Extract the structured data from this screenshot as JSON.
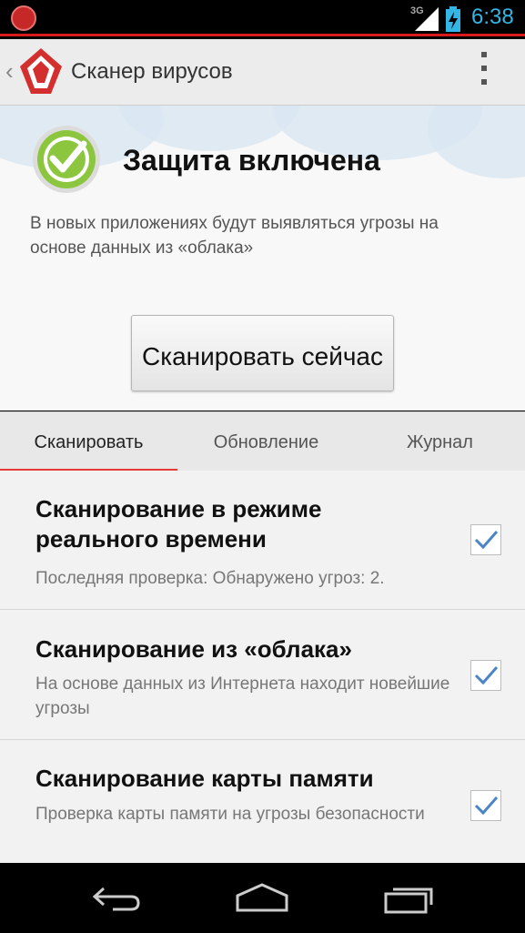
{
  "status_bar": {
    "network": "3G",
    "time": "6:38"
  },
  "action_bar": {
    "title": "Сканер вирусов"
  },
  "protection": {
    "title": "Защита включена",
    "description": "В новых приложениях будут выявляться угрозы на основе данных из «облака»",
    "scan_button": "Сканировать сейчас"
  },
  "tabs": [
    "Сканировать",
    "Обновление",
    "Журнал"
  ],
  "settings": [
    {
      "title": "Сканирование в режиме реального времени",
      "subtitle": "Последняя проверка: Обнаружено угроз: 2.",
      "checked": true
    },
    {
      "title": "Сканирование из «облака»",
      "subtitle": "На основе данных из Интернета находит новейшие угрозы",
      "checked": true
    },
    {
      "title": "Сканирование карты памяти",
      "subtitle": "Проверка карты памяти на угрозы безопасности",
      "checked": true
    }
  ],
  "colors": {
    "accent": "#e53935",
    "time": "#33b5e5",
    "check": "#4a86c5"
  }
}
